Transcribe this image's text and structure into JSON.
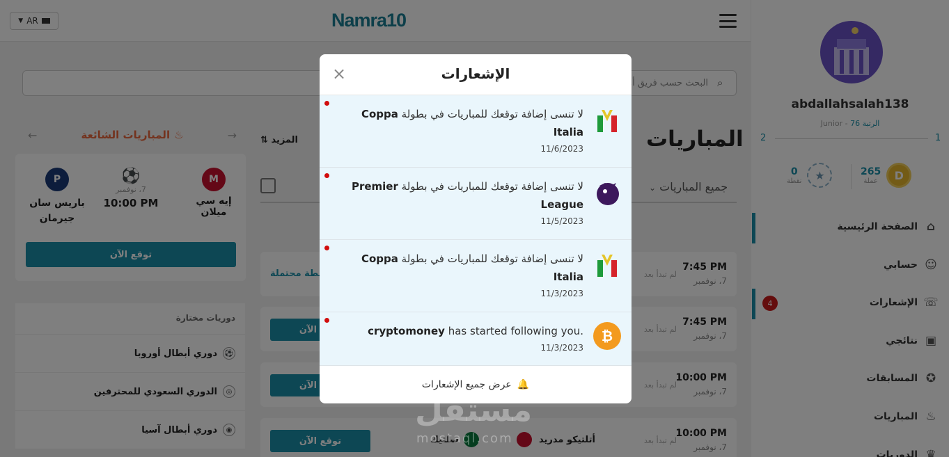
{
  "header": {
    "brand": "Namra10",
    "language": "AR"
  },
  "search": {
    "placeholder": "البحث حسب فريق أو"
  },
  "popular": {
    "title": "المباريات الشائعة",
    "home_team": "إيه سي ميلان",
    "away_team": "باريس سان جيرمان",
    "date": "7، نوفمبر",
    "time": "10:00 PM",
    "predict_label": "توقع الآن"
  },
  "leagues": {
    "title": "دوريات مختارة",
    "items": [
      "دوري أبطال أوروبا",
      "الدوري السعودي للمحترفين",
      "دوري أبطال آسيا"
    ]
  },
  "matches": {
    "title": "المباريات",
    "more_label": "المزيد",
    "filter_label": "جميع المباريات",
    "points_label": "قطة محتملة",
    "not_started": "لم تبدأ بعد",
    "predict_label": "توقع الآن",
    "rows": [
      {
        "time": "7:45 PM",
        "date": "7، نوفمبر"
      },
      {
        "time": "7:45 PM",
        "date": "7، نوفمبر"
      },
      {
        "time": "10:00 PM",
        "date": "7، نوفمبر"
      },
      {
        "time": "10:00 PM",
        "date": "7، نوفمبر",
        "home": "أتلتيكو مدريد",
        "away": "سلتيك"
      }
    ]
  },
  "profile": {
    "username": "abdallahsalah138",
    "rank_level": "Junior",
    "rank_text": "الرتبة 76",
    "level_current": "1",
    "level_next": "2",
    "coins": "265",
    "coins_label": "عملة",
    "points": "0",
    "points_label": "نقطة"
  },
  "nav": {
    "items": [
      {
        "label": "الصفحة الرئيسية",
        "icon": "home-icon"
      },
      {
        "label": "حسابي",
        "icon": "user-icon"
      },
      {
        "label": "الإشعارات",
        "icon": "chat-icon"
      },
      {
        "label": "نتائجي",
        "icon": "results-icon"
      },
      {
        "label": "المسابقات",
        "icon": "medal-icon"
      },
      {
        "label": "المباريات",
        "icon": "fire-icon"
      },
      {
        "label": "الدوريات",
        "icon": "trophy-icon"
      }
    ],
    "notifications_badge": "4"
  },
  "modal": {
    "title": "الإشعارات",
    "footer": "عرض جميع الإشعارات",
    "notifications": [
      {
        "prefix": "لا تنسى إضافة توقعك للمباريات في بطولة",
        "league": "Coppa Italia",
        "date": "11/6/2023",
        "icon": "coppa-italia-icon"
      },
      {
        "prefix": "لا تنسى إضافة توقعك للمباريات في بطولة",
        "league": "Premier League",
        "date": "11/5/2023",
        "icon": "premier-league-icon"
      },
      {
        "prefix": "لا تنسى إضافة توقعك للمباريات في بطولة",
        "league": "Coppa Italia",
        "date": "11/3/2023",
        "icon": "coppa-italia-icon"
      },
      {
        "user": "cryptomoney",
        "text": "has started following you",
        "date": "11/3/2023",
        "icon": "bitcoin-icon"
      }
    ]
  },
  "watermark": {
    "text": "مستقل",
    "domain": "mostaql.com"
  },
  "colors": {
    "accent": "#1a8fa8",
    "popular": "#e8673d",
    "unread_dot": "#d10d0d",
    "badge": "#c91a1a"
  }
}
